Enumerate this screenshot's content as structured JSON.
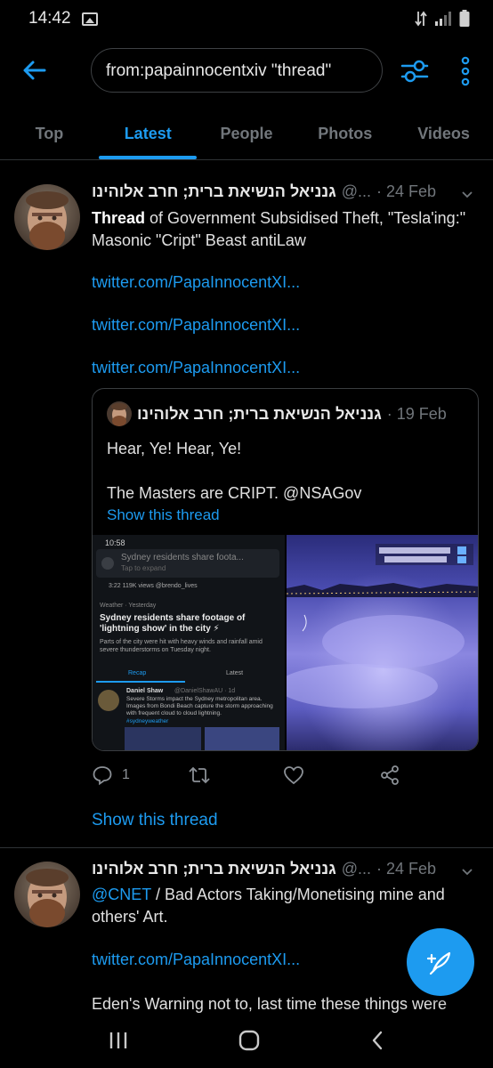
{
  "status_bar": {
    "time": "14:42",
    "icons": [
      "gallery-icon",
      "data-arrows-icon",
      "signal-icon",
      "battery-icon"
    ]
  },
  "search": {
    "query": "from:papainnocentxiv \"thread\""
  },
  "tabs": [
    {
      "label": "Top",
      "active": false
    },
    {
      "label": "Latest",
      "active": true
    },
    {
      "label": "People",
      "active": false
    },
    {
      "label": "Photos",
      "active": false
    },
    {
      "label": "Videos",
      "active": false
    }
  ],
  "tweets": [
    {
      "author_name": "גנניאל הנשיאת ברית; חרב אלוהינו",
      "handle": "@...",
      "date": "· 24 Feb",
      "text_bold": "Thread",
      "text_rest": " of Government Subsidised Theft, \"Tesla'ing:\" Masonic \"Cript\" Beast antiLaw",
      "links": [
        "twitter.com/PapaInnocentXI...",
        "twitter.com/PapaInnocentXI...",
        "twitter.com/PapaInnocentXI..."
      ],
      "quote": {
        "author_name": "גנניאל הנשיאת ברית; חרב אלוהינו",
        "date": "· 19 Feb",
        "line1": "Hear, Ye! Hear, Ye!",
        "line2": "The Masters are CRIPT. @NSAGov",
        "show_thread": "Show this thread",
        "media_left": {
          "time": "10:58",
          "header": "Sydney residents share foota...",
          "subheader": "Tap to expand",
          "video_stats": "3:22   119K views   @brendo_lives",
          "category": "Weather · Yesterday",
          "headline": "Sydney residents share footage of 'lightning show' in the city ⚡",
          "summary": "Parts of the city were hit with heavy winds and rainfall amid severe thunderstorms on Tuesday night.",
          "tab_recap": "Recap",
          "tab_latest": "Latest",
          "inner_author": "Daniel Shaw",
          "inner_handle": "@DanielShawAU · 1d",
          "inner_text": "Severe Storms impact the Sydney metropolitan area. Images from Bondi Beach capture the storm approaching with frequent cloud to cloud lightning.",
          "inner_tag": "#sydneyweather"
        }
      },
      "actions": {
        "reply_count": "1",
        "retweet_count": "",
        "like_count": ""
      },
      "show_thread": "Show this thread"
    },
    {
      "author_name": "גנניאל הנשיאת ברית; חרב אלוהינו",
      "handle": "@...",
      "date": "· 24 Feb",
      "mention": "@CNET",
      "text_rest": " / Bad Actors Taking/Monetising mine and others' Art.",
      "link": "twitter.com/PapaInnocentXI...",
      "text_tail": "Eden's Warning not to, last time these things were"
    }
  ],
  "colors": {
    "accent": "#1d9bf0",
    "background": "#000000",
    "muted": "#71767b",
    "border": "#2f3336"
  }
}
